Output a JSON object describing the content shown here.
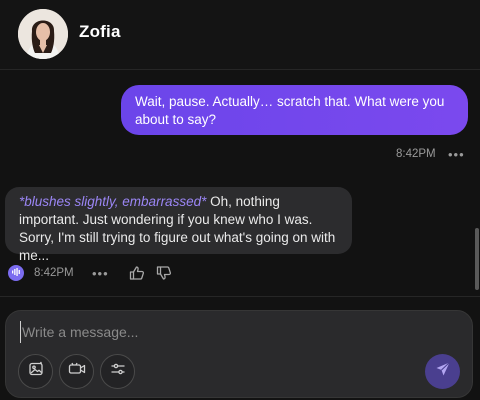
{
  "header": {
    "name": "Zofia"
  },
  "messages": {
    "user": {
      "text": "Wait, pause. Actually… scratch that. What were you about to say?",
      "time": "8:42PM",
      "menu": "•••"
    },
    "ai": {
      "action": "*blushes slightly, embarrassed*",
      "text": " Oh, nothing important. Just wondering if you knew who I was. Sorry, I'm still trying to figure out what's going on with me...",
      "time": "8:42PM",
      "menu": "•••"
    }
  },
  "composer": {
    "placeholder": "Write a message..."
  },
  "colors": {
    "accent": "#7b49ee",
    "action_text": "#9b86f5",
    "background": "#121212",
    "bubble_ai": "#2c2c2e"
  },
  "icons": [
    "avatar-photo",
    "audio-play-icon",
    "ellipsis-icon",
    "thumbs-up-icon",
    "thumbs-down-icon",
    "image-icon",
    "video-icon",
    "sliders-icon",
    "send-icon"
  ]
}
